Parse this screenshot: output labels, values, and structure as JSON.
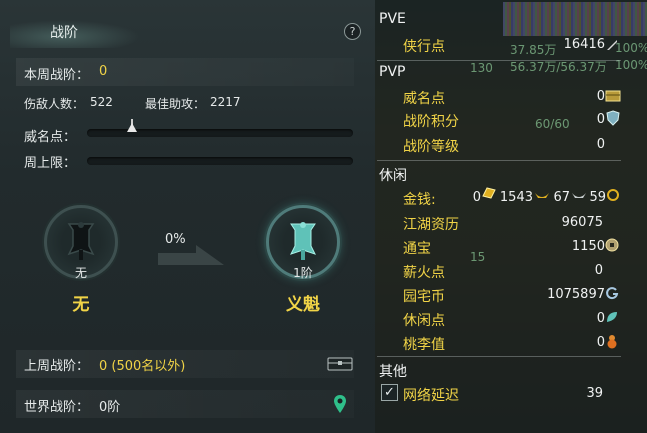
{
  "left": {
    "title": "战阶",
    "help_label": "?",
    "weekly_rank_label": "本周战阶：",
    "weekly_rank_value": "0",
    "kills_label": "伤敌人数：",
    "kills_value": "522",
    "best_assist_label": "最佳助攻：",
    "best_assist_value": "2217",
    "prestige_label": "威名点：",
    "weekly_limit_label": "周上限：",
    "current_rank_caption": "无",
    "current_rank_name": "无",
    "progress_percent": "0%",
    "next_rank_caption": "1阶",
    "next_rank_name": "义魁",
    "last_week_label": "上周战阶：",
    "last_week_value": "0 (500名以外)",
    "world_rank_label": "世界战阶：",
    "world_rank_value": "0阶",
    "prestige_progress": 0.17,
    "weekly_limit_progress": 0
  },
  "right": {
    "top_cut_text": "PVE  ·  ·  ·  ",
    "ghost_texts": [
      "37.85万",
      "56.37万/56.37万",
      "130",
      "60/60",
      "15",
      "100%",
      "100%"
    ],
    "pve_section": "PVE",
    "pve_items": [
      {
        "label": "侠行点",
        "value": "16416",
        "icon": "sword-icon"
      }
    ],
    "pvp_section": "PVP",
    "pvp_items": [
      {
        "label": "威名点",
        "value": "0",
        "icon": "chest-icon"
      },
      {
        "label": "战阶积分",
        "value": "0",
        "icon": "shield-icon"
      },
      {
        "label": "战阶等级",
        "value": "0",
        "icon": ""
      }
    ],
    "leisure_section": "休闲",
    "money_label": "金钱:",
    "money_values": [
      "0",
      "1543",
      "67",
      "59"
    ],
    "leisure_items": [
      {
        "label": "江湖资历",
        "value": "96075",
        "icon": ""
      },
      {
        "label": "通宝",
        "value": "1150",
        "icon": "coin-icon"
      },
      {
        "label": "薪火点",
        "value": "0",
        "icon": ""
      },
      {
        "label": "园宅币",
        "value": "1075897",
        "icon": "g-coin-icon"
      },
      {
        "label": "休闲点",
        "value": "0",
        "icon": "leaf-icon"
      },
      {
        "label": "桃李值",
        "value": "0",
        "icon": "gourd-icon"
      }
    ],
    "other_section": "其他",
    "latency_label": "网络延迟",
    "latency_value": "39",
    "latency_checked": "✓"
  },
  "colors": {
    "label_yellow": "#f1d447",
    "text_white": "#e6eaea",
    "panel_dark": "#222b2d"
  }
}
